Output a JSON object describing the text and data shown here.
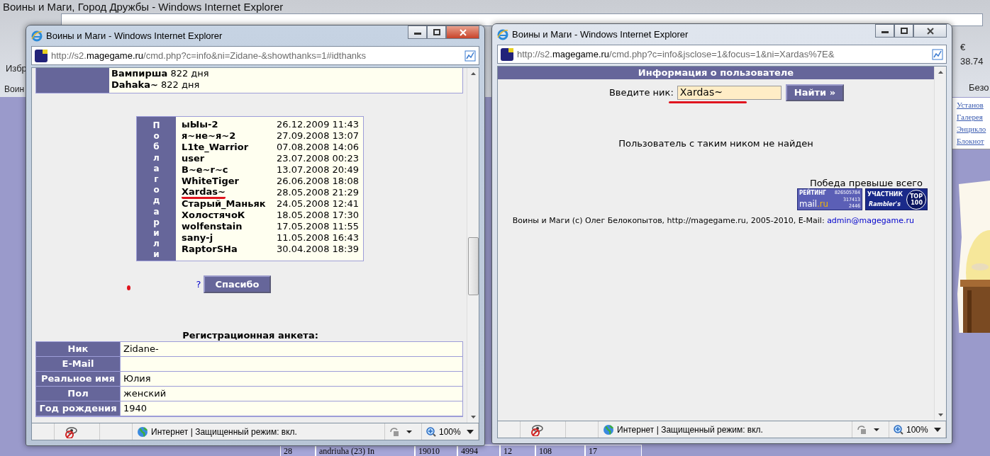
{
  "background": {
    "title": "Воины и Маги, Город Дружбы - Windows Internet Explorer",
    "favorites": "Избр",
    "tab": "Воин",
    "menu": "Безо",
    "rate": "€ 38.74",
    "links": [
      "Установ",
      "Галерея",
      "Энцикло",
      "Блокнот"
    ],
    "table_row": [
      "28",
      "andriuha (23) In",
      "19010",
      "4994",
      "12",
      "108",
      "17"
    ]
  },
  "windows": [
    {
      "title": "Воины и Маги - Windows Internet Explorer",
      "active": true,
      "address": {
        "prefix": "http://s2.",
        "domain": "magegame.ru",
        "rest": "/cmd.php?c=info&ni=Zidane-&showthanks=1#idthanks"
      },
      "status": "Интернет | Защищенный режим: вкл.",
      "zoom": "100%",
      "content": {
        "kind": "profile",
        "rank_list": [
          {
            "name": "Вампирша",
            "days": "822 дня"
          },
          {
            "name": "Dahaka~",
            "days": "822 дня"
          }
        ],
        "thanks_label": "Поблагодарили",
        "thanks": [
          {
            "name": "ыЫы-2",
            "date": "26.12.2009 11:43",
            "marked": false
          },
          {
            "name": "я~не~я~2",
            "date": "27.09.2008 13:07",
            "marked": false
          },
          {
            "name": "L1te_Warrior",
            "date": "07.08.2008 14:06",
            "marked": false
          },
          {
            "name": "user",
            "date": "23.07.2008 00:23",
            "marked": false
          },
          {
            "name": "B~e~r~c",
            "date": "13.07.2008 20:49",
            "marked": false
          },
          {
            "name": "WhiteTiger",
            "date": "26.06.2008 18:08",
            "marked": false
          },
          {
            "name": "Xardas~",
            "date": "28.05.2008 21:29",
            "marked": true
          },
          {
            "name": "Старый_Маньяк",
            "date": "24.05.2008 12:41",
            "marked": false
          },
          {
            "name": "ХолостячоК",
            "date": "18.05.2008 17:30",
            "marked": false
          },
          {
            "name": "wolfenstain",
            "date": "17.05.2008 11:55",
            "marked": false
          },
          {
            "name": "sany-j",
            "date": "11.05.2008 16:43",
            "marked": false
          },
          {
            "name": "RaptorSHa",
            "date": "30.04.2008 18:39",
            "marked": false
          }
        ],
        "help_link": "?",
        "thanks_button": "Спасибо",
        "red_dot": true,
        "form_title": "Регистрационная анкета:",
        "form": [
          {
            "label": "Ник",
            "value": "Zidane-"
          },
          {
            "label": "E-Mail"
          },
          {
            "label": "Реальное имя",
            "value": "Юлия"
          },
          {
            "label": "Пол",
            "value": "женский"
          },
          {
            "label": "Год рождения",
            "value": "1940"
          }
        ]
      }
    },
    {
      "title": "Воины и Маги - Windows Internet Explorer",
      "active": false,
      "address": {
        "prefix": "http://s2.",
        "domain": "magegame.ru",
        "rest": "/cmd.php?c=info&jsclose=1&focus=1&ni=Xardas%7E&"
      },
      "status": "Интернет | Защищенный режим: вкл.",
      "zoom": "100%",
      "content": {
        "kind": "search",
        "header": "Информация о пользователе",
        "label": "Введите ник:",
        "value": "Xardas~",
        "marked": true,
        "button": "Найти »",
        "message": "Пользователь с таким ником не найден",
        "motto": "Победа превыше всего",
        "mailru": {
          "label": "РЕЙТИНГ",
          "total": "826505784",
          "brand": "mail",
          "suffix": ".ru",
          "today": "317413",
          "online": "2446"
        },
        "rambler": {
          "label": "УЧАСТНИК",
          "brand": "Rambler's",
          "top": "TOP",
          "rank": "100"
        },
        "footer": "Воины и Маги (c) Олег Белокопытов, http://magegame.ru, 2005-2010, E-Mail:",
        "email": "admin@magegame.ru"
      }
    }
  ]
}
